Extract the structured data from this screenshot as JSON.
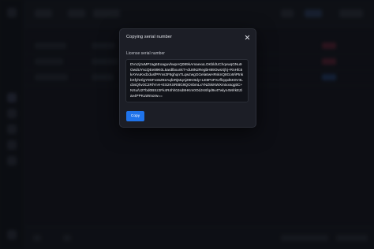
{
  "dialog": {
    "title": "Copying serial number",
    "close_icon": "close-icon",
    "field_label": "License serial number",
    "serial_value": "DVxzj2uMPzag6EoaguvhwpAQ089kAmaexuLOKbldUChqvwqGNu9OwdUYscQEe89K0L5ardlbxunkT+dU8N2RegbH89OwsXjhj+RnHfc5kAYvuKvdzdusfPFms3F8ghqnTLqwzwgGGela6wHRsknQ8Go9/iPtnkbXfyhHlgY9SFvs5Z82AqfeRjMqAj29K0tdy+LE8P4PXJffJppd5K0V3LcbsQhv3C2RlYnH+ES2KSRt8G9QOnbmLxYNZ5kNWXmtxxsqgttC+NXu/U2Tbd0BSz2Fk4R4hh0Jsd8HKm0OdJnSfqd9x4Twlyn4M/rkEZiav4PPKuWmorw==",
    "copy_label": "Copy",
    "accent_color": "#1f73ea"
  }
}
